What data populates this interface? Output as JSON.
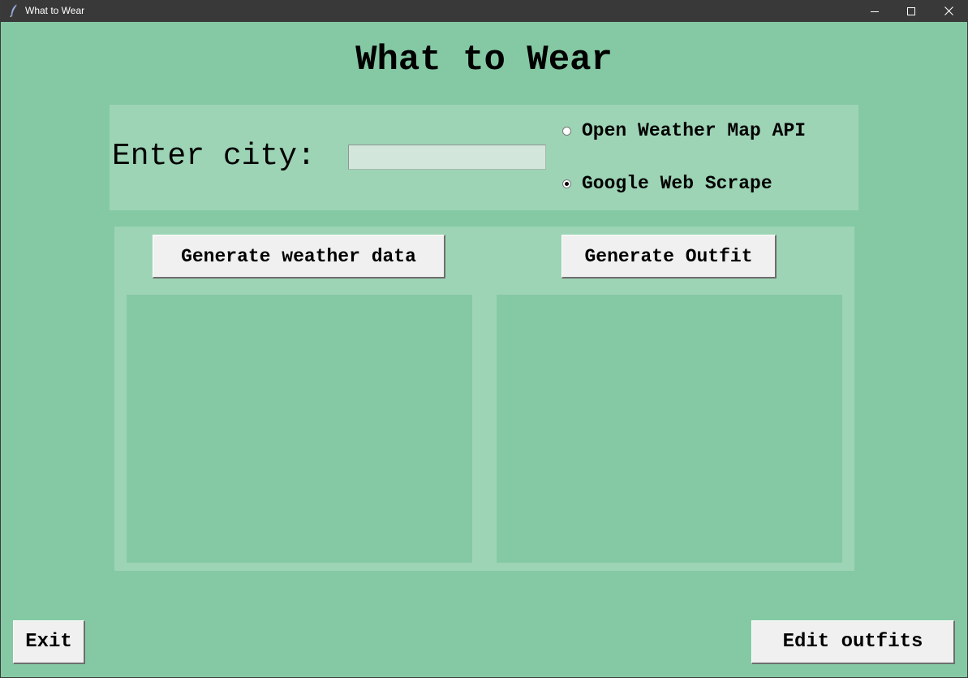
{
  "window": {
    "title": "What to Wear",
    "icon": "feather-icon",
    "controls": {
      "minimize_icon": "minimize-icon",
      "maximize_icon": "maximize-icon",
      "close_icon": "close-icon"
    }
  },
  "header": {
    "title": "What to Wear"
  },
  "city": {
    "label": "Enter city:",
    "value": "",
    "placeholder": ""
  },
  "source": {
    "options": [
      {
        "label": "Open Weather Map API",
        "selected": false
      },
      {
        "label": "Google Web Scrape",
        "selected": true
      }
    ]
  },
  "actions": {
    "generate_weather_label": "Generate weather data",
    "generate_outfit_label": "Generate Outfit"
  },
  "output": {
    "weather_text": "",
    "outfit_text": ""
  },
  "footer": {
    "exit_label": "Exit",
    "edit_outfits_label": "Edit outfits"
  },
  "colors": {
    "background": "#85c9a4",
    "panel": "#9dd4b5",
    "titlebar": "#393939",
    "button": "#f0f0f0"
  }
}
